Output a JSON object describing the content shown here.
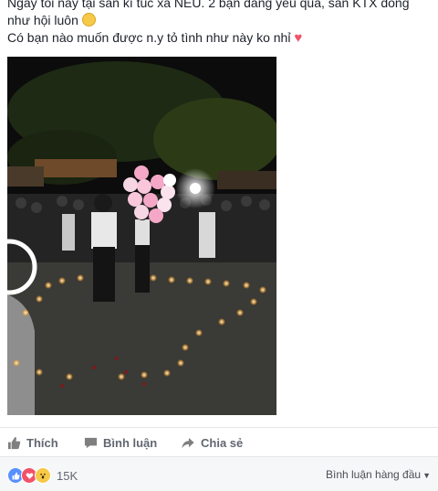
{
  "post": {
    "line1": "Ngày tối nay tại sân kí túc xá NEU. 2 bạn đáng yêu quá, sân KTX đông",
    "line2": "như hội luôn",
    "line3": "Có bạn nào muốn được n.y tỏ tình như này ko nhỉ",
    "emoji_icons": [
      "grin-emoji-icon",
      "heart-emoji-icon"
    ]
  },
  "actions": {
    "like": "Thích",
    "comment": "Bình luận",
    "share": "Chia sẻ"
  },
  "footer": {
    "reaction_count": "15K",
    "reaction_icons": [
      "like-reaction-icon",
      "love-reaction-icon",
      "wow-reaction-icon"
    ],
    "sort_label": "Bình luận hàng đầu"
  },
  "colors": {
    "like_blue": "#5890ff",
    "love_red": "#f25268",
    "wow_yellow": "#f7c948",
    "action_gray": "#616770"
  }
}
